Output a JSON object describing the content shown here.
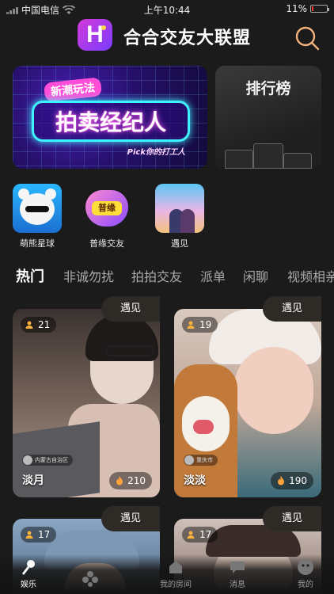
{
  "status_bar": {
    "carrier": "中国电信",
    "time": "上午10:44",
    "battery": "11%",
    "battery_level": 0.11
  },
  "header": {
    "logo_letter": "H",
    "title": "合合交友大联盟",
    "search_icon": "search-icon"
  },
  "banner": {
    "subtitle": "新潮玩法",
    "title": "拍卖经纪人",
    "footer": "Pick你的打工人"
  },
  "rank_card": {
    "title": "排行榜"
  },
  "quick_links": [
    {
      "label": "萌熊星球",
      "icon": "bear-icon"
    },
    {
      "label": "普缘交友",
      "badge": "普缘",
      "icon": "heart-icon"
    },
    {
      "label": "遇见",
      "icon": "couple-image"
    }
  ],
  "tabs": [
    "热门",
    "非诚勿扰",
    "拍拍交友",
    "派单",
    "闲聊",
    "视频相亲"
  ],
  "cards": [
    {
      "tag": "遇见",
      "viewers": "21",
      "name": "淡月",
      "heat": "210",
      "location": "内蒙古自治区"
    },
    {
      "tag": "遇见",
      "viewers": "19",
      "name": "淡淡",
      "heat": "190",
      "location": "重庆市"
    },
    {
      "tag": "遇见",
      "viewers": "17"
    },
    {
      "tag": "遇见",
      "viewers": "17"
    }
  ],
  "nav": [
    {
      "label": "娱乐",
      "icon": "microphone-icon",
      "active": true
    },
    {
      "label": "",
      "icon": "apps-icon"
    },
    {
      "label": "我的房间",
      "icon": "house-icon"
    },
    {
      "label": "消息",
      "icon": "chat-icon"
    },
    {
      "label": "我的",
      "icon": "profile-icon"
    }
  ]
}
